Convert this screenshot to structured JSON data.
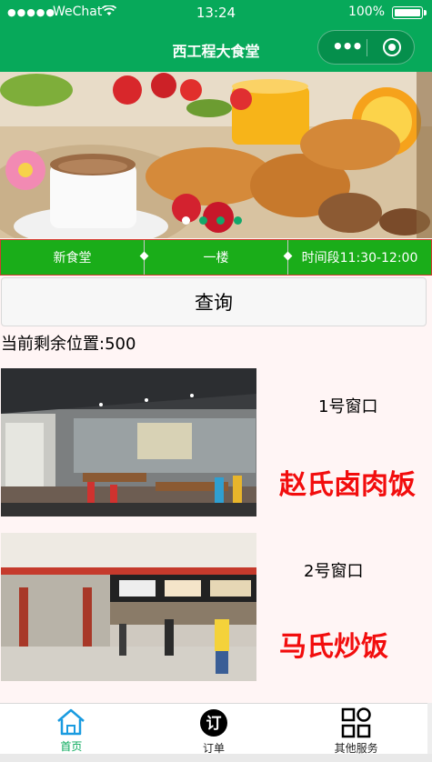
{
  "status_bar": {
    "signal": "●●●●●",
    "carrier": "WeChat",
    "time": "13:24",
    "battery_pct": "100%"
  },
  "header": {
    "title": "西工程大食堂",
    "more_icon": "ellipsis-icon",
    "close_icon": "target-icon",
    "color": "#07a95a"
  },
  "banner": {
    "dot_count": 4,
    "active_dot": 0
  },
  "pickers": [
    {
      "label": "新食堂"
    },
    {
      "label": "一楼"
    },
    {
      "label": "时间段11:30-12:00"
    }
  ],
  "query": {
    "label": "查询"
  },
  "remaining": {
    "text": "当前剩余位置:500"
  },
  "windows": [
    {
      "window": "1号窗口",
      "food": "赵氏卤肉饭"
    },
    {
      "window": "2号窗口",
      "food": "马氏炒饭"
    }
  ],
  "tabbar": {
    "items": [
      {
        "label": "首页",
        "icon": "home-icon",
        "active": true
      },
      {
        "label": "订单",
        "icon": "order-icon",
        "active": false
      },
      {
        "label": "其他服务",
        "icon": "grid-icon",
        "active": false
      }
    ],
    "active_color": "#07a95a"
  }
}
